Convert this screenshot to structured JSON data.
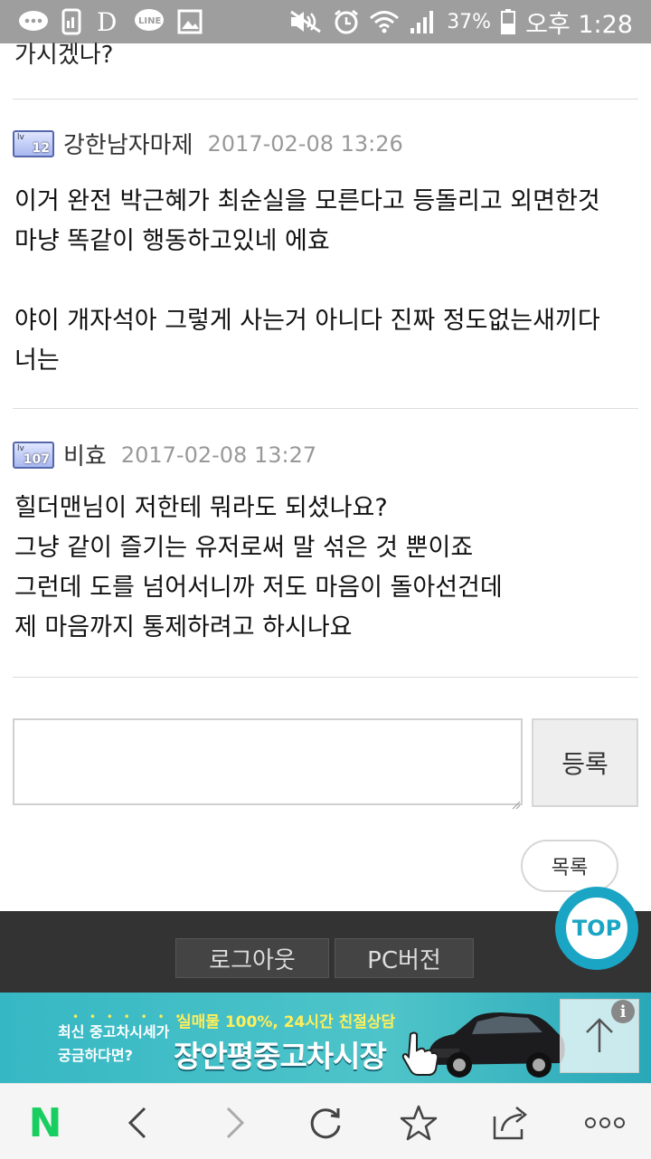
{
  "status_bar": {
    "icons": [
      "chat-bubble-icon",
      "phone-icon",
      "daum-d-icon",
      "line-icon",
      "image-icon",
      "mute-icon",
      "alarm-icon",
      "wifi-icon",
      "signal-icon",
      "battery-icon"
    ],
    "battery": "37%",
    "time": "오후 1:28"
  },
  "previous_comment_tail": "가시겠나?",
  "comments": [
    {
      "level": "12",
      "nickname": "강한남자마제",
      "date": "2017-02-08 13:26",
      "lines": [
        "이거 완전 박근혜가 최순실을 모른다고 등돌리고 외면한것",
        "마냥 똑같이 행동하고있네 에효",
        "",
        "야이 개자석아 그렇게 사는거 아니다 진짜 정도없는새끼다",
        "너는"
      ]
    },
    {
      "level": "107",
      "nickname": "비효",
      "date": "2017-02-08 13:27",
      "lines": [
        "힐더맨님이 저한테 뭐라도 되셨나요?",
        "그냥 같이 즐기는 유저로써 말 섞은 것 뿐이죠",
        "그런데 도를 넘어서니까 저도 마음이 돌아선건데",
        "제 마음까지 통제하려고 하시나요"
      ]
    }
  ],
  "level_prefix": "lv",
  "comment_form": {
    "input_value": "",
    "submit_label": "등록"
  },
  "list_button": "목록",
  "top_button": "TOP",
  "footer": {
    "logout": "로그아웃",
    "pc_version": "PC버전"
  },
  "ad": {
    "left_line1": "최신 중고차시세가",
    "left_line2": "궁금하다면?",
    "promo": "실매물 100%, 24시간 친절상담",
    "brand": "장안평중고차시장",
    "info_icon": "i"
  },
  "browser_nav": {
    "logo": "N",
    "items": [
      "back-icon",
      "forward-icon",
      "reload-icon",
      "bookmark-star-icon",
      "share-icon",
      "more-icon"
    ]
  }
}
